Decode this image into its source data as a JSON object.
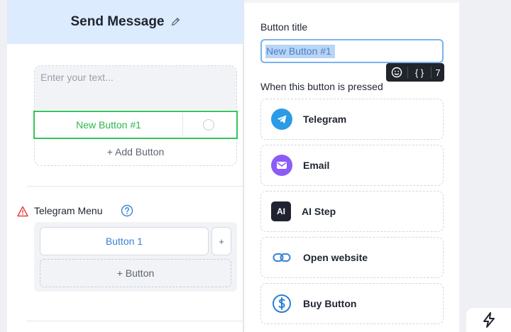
{
  "node": {
    "title": "Send Message",
    "message_placeholder": "Enter your text...",
    "selected_button_label": "New Button #1",
    "add_button_label": "+ Add Button",
    "menu": {
      "label": "Telegram Menu",
      "button_label": "Button 1",
      "plus_label": "+",
      "add_label": "+ Button"
    }
  },
  "panel": {
    "field_label": "Button title",
    "title_value": "New Button #1",
    "toolbar": {
      "emoji_icon": "emoji-icon",
      "variables_label": "{ }",
      "count_label": "7"
    },
    "pressed_label": "When this button is pressed",
    "actions": [
      {
        "label": "Telegram",
        "icon": "telegram-icon",
        "color": "#2b9be6"
      },
      {
        "label": "Email",
        "icon": "email-icon",
        "color": "#8b5cf6"
      },
      {
        "label": "AI Step",
        "icon": "ai-icon",
        "color": "#1f2430",
        "icon_text": "AI"
      },
      {
        "label": "Open website",
        "icon": "link-icon",
        "color": "#3b82d6"
      },
      {
        "label": "Buy Button",
        "icon": "dollar-icon",
        "color": "#2b7fd4"
      }
    ]
  },
  "colors": {
    "header_bg": "#dcebfd",
    "selected_green": "#34c65a",
    "input_focus": "#7ab3f0",
    "link_blue": "#3b82d6",
    "warning_red": "#e0453b"
  }
}
